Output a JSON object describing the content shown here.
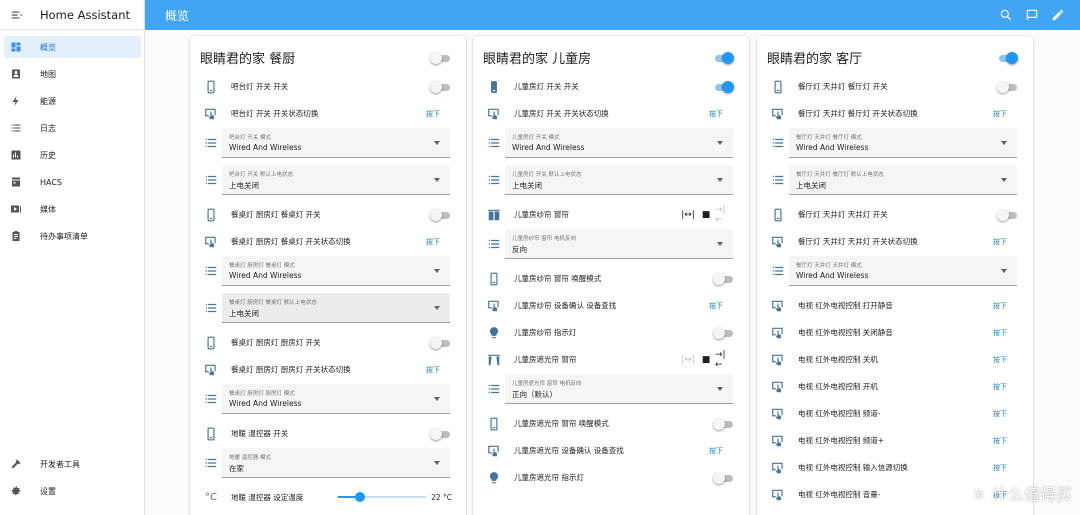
{
  "app": {
    "title": "Home Assistant"
  },
  "header": {
    "title": "概览"
  },
  "sidebar": {
    "items": [
      {
        "label": "概览",
        "icon": "dashboard-icon",
        "active": true
      },
      {
        "label": "地图",
        "icon": "map-icon"
      },
      {
        "label": "能源",
        "icon": "lightning-icon"
      },
      {
        "label": "日志",
        "icon": "log-icon"
      },
      {
        "label": "历史",
        "icon": "history-chart-icon"
      },
      {
        "label": "HACS",
        "icon": "hacs-icon"
      },
      {
        "label": "媒体",
        "icon": "media-icon"
      },
      {
        "label": "待办事项清单",
        "icon": "clipboard-icon"
      }
    ],
    "bottom": [
      {
        "label": "开发者工具",
        "icon": "hammer-icon"
      },
      {
        "label": "设置",
        "icon": "gear-icon"
      }
    ]
  },
  "cards": [
    {
      "title": "眼睛君的家 餐厨",
      "header_toggle": false,
      "rows": [
        {
          "label": "吧台灯 开关 开关",
          "kind": "toggle",
          "on": false
        },
        {
          "label": "吧台灯 开关 开关状态切换",
          "kind": "button",
          "action": "按下"
        },
        {
          "kind": "select",
          "label": "吧台灯 开关 模式",
          "value": "Wired And Wireless"
        },
        {
          "kind": "select",
          "label": "吧台灯 开关 默认上电状态",
          "value": "上电关闭"
        },
        {
          "label": "餐桌灯 厨房灯 餐桌灯 开关",
          "kind": "toggle",
          "on": false
        },
        {
          "label": "餐桌灯 厨房灯 餐桌灯 开关状态切换",
          "kind": "button",
          "action": "按下"
        },
        {
          "kind": "select",
          "label": "餐桌灯 厨房灯 餐桌灯 模式",
          "value": "Wired And Wireless"
        },
        {
          "kind": "select",
          "label": "餐桌灯 厨房灯 餐桌灯 默认上电状态",
          "value": "上电关闭",
          "dark": true
        },
        {
          "label": "餐桌灯 厨房灯 厨房灯 开关",
          "kind": "toggle",
          "on": false
        },
        {
          "label": "餐桌灯 厨房灯 厨房灯 开关状态切换",
          "kind": "button",
          "action": "按下"
        },
        {
          "kind": "select",
          "label": "餐桌灯 厨房灯 厨房灯 模式",
          "value": "Wired And Wireless"
        },
        {
          "label": "地暖 温控器 开关",
          "kind": "toggle",
          "on": false
        },
        {
          "kind": "select",
          "label": "地暖 温控器 模式",
          "value": "在家"
        },
        {
          "label": "地暖 温控器 设定温度",
          "kind": "slider",
          "value": "22 °C",
          "level": 0.25
        }
      ]
    },
    {
      "title": "眼睛君的家 儿童房",
      "header_toggle": true,
      "rows": [
        {
          "label": "儿童房灯 开关 开关",
          "kind": "toggle",
          "on": true
        },
        {
          "label": "儿童房灯 开关 开关状态切换",
          "kind": "button",
          "action": "按下"
        },
        {
          "kind": "select",
          "label": "儿童房灯 开关 模式",
          "value": "Wired And Wireless"
        },
        {
          "kind": "select",
          "label": "儿童房灯 开关 默认上电状态",
          "value": "上电关闭"
        },
        {
          "label": "儿童房纱帘 窗帘",
          "kind": "cover"
        },
        {
          "kind": "select",
          "label": "儿童房纱帘 窗帘 电机反向",
          "value": "反向"
        },
        {
          "label": "儿童房纱帘 窗帘 唤醒模式",
          "kind": "toggle",
          "on": false
        },
        {
          "label": "儿童房纱帘 设备确认 设备查找",
          "kind": "button",
          "action": "按下"
        },
        {
          "label": "儿童房纱帘 指示灯",
          "kind": "toggle",
          "on": false
        },
        {
          "label": "儿童房遮光帘 窗帘",
          "kind": "cover2"
        },
        {
          "kind": "select",
          "label": "儿童房遮光帘 窗帘 电机反向",
          "value": "正向（默认）"
        },
        {
          "label": "儿童房遮光帘 窗帘 唤醒模式",
          "kind": "toggle",
          "on": false
        },
        {
          "label": "儿童房遮光帘 设备确认 设备查找",
          "kind": "button",
          "action": "按下"
        },
        {
          "label": "儿童房遮光帘 指示灯",
          "kind": "toggle",
          "on": false
        }
      ]
    },
    {
      "title": "眼睛君的家 客厅",
      "header_toggle": true,
      "rows": [
        {
          "label": "餐厅灯 天井灯 餐厅灯 开关",
          "kind": "toggle",
          "on": false
        },
        {
          "label": "餐厅灯 天井灯 餐厅灯 开关状态切换",
          "kind": "button",
          "action": "按下"
        },
        {
          "kind": "select",
          "label": "餐厅灯 天井灯 餐厅灯 模式",
          "value": "Wired And Wireless"
        },
        {
          "kind": "select",
          "label": "餐厅灯 天井灯 餐厅灯 默认上电状态",
          "value": "上电关闭"
        },
        {
          "label": "餐厅灯 天井灯 天井灯 开关",
          "kind": "toggle",
          "on": false
        },
        {
          "label": "餐厅灯 天井灯 天井灯 开关状态切换",
          "kind": "button",
          "action": "按下"
        },
        {
          "kind": "select",
          "label": "餐厅灯 天井灯 天井灯 模式",
          "value": "Wired And Wireless"
        },
        {
          "label": "电视 红外电视控制 打开静音",
          "kind": "button",
          "action": "按下"
        },
        {
          "label": "电视 红外电视控制 关闭静音",
          "kind": "button",
          "action": "按下"
        },
        {
          "label": "电视 红外电视控制 关机",
          "kind": "button",
          "action": "按下"
        },
        {
          "label": "电视 红外电视控制 开机",
          "kind": "button",
          "action": "按下"
        },
        {
          "label": "电视 红外电视控制 频道-",
          "kind": "button",
          "action": "按下"
        },
        {
          "label": "电视 红外电视控制 频道+",
          "kind": "button",
          "action": "按下"
        },
        {
          "label": "电视 红外电视控制 输入信源切换",
          "kind": "button",
          "action": "按下"
        },
        {
          "label": "电视 红外电视控制 音量-",
          "kind": "button",
          "action": "按下"
        }
      ]
    }
  ],
  "watermark": {
    "text": "什么值得买",
    "badge": "值"
  }
}
